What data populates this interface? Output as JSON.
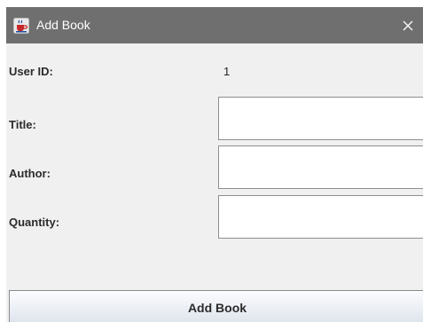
{
  "window": {
    "title": "Add Book"
  },
  "form": {
    "user_id_label": "User ID:",
    "user_id_value": "1",
    "title_label": "Title:",
    "title_value": "",
    "author_label": "Author:",
    "author_value": "",
    "quantity_label": "Quantity:",
    "quantity_value": ""
  },
  "actions": {
    "submit_label": "Add Book"
  },
  "icons": {
    "app": "java-cup-icon",
    "close": "close-icon"
  },
  "colors": {
    "titlebar": "#6f6f6f",
    "window_bg": "#f0f0f0",
    "input_bg": "#ffffff",
    "button_top": "#fbfcfe",
    "button_bottom": "#dde3ec"
  }
}
